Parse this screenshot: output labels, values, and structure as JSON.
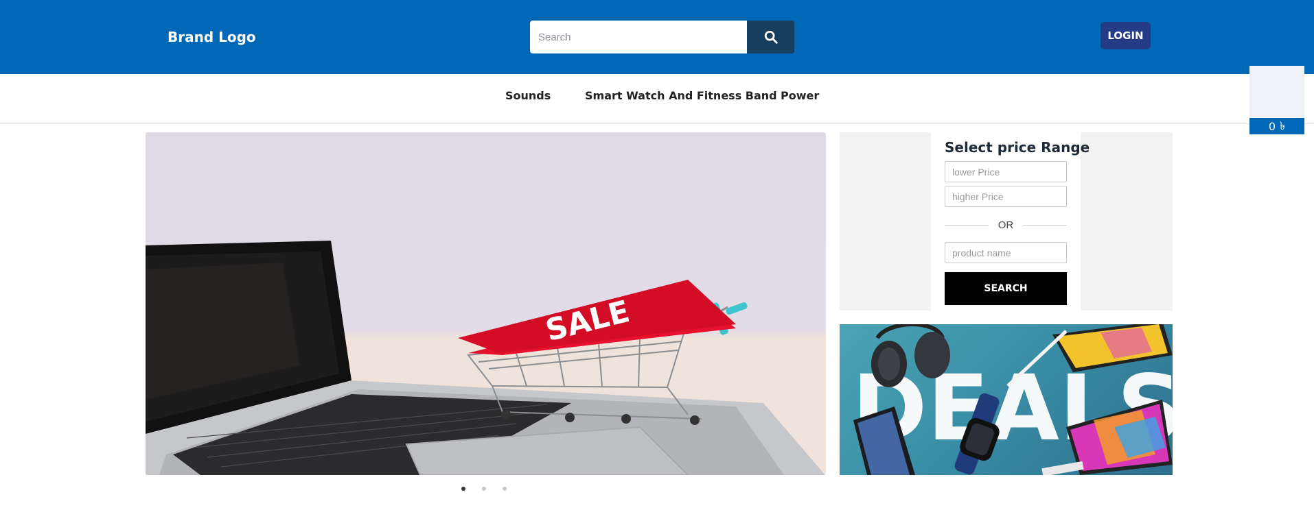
{
  "header": {
    "brand": "Brand Logo",
    "search_placeholder": "Search",
    "login_label": "LOGIN",
    "colors": {
      "bar": "#0068b7",
      "search_button": "#173e5c",
      "login_button": "#253b85"
    }
  },
  "nav": {
    "items": [
      {
        "label": "Sounds"
      },
      {
        "label": "Smart Watch And Fitness Band"
      },
      {
        "label": "Power"
      }
    ]
  },
  "cart": {
    "count": "0",
    "currency_symbol": "৳"
  },
  "hero": {
    "sale_text": "SALE",
    "slides": 3,
    "active_slide": 1
  },
  "filter": {
    "title": "Select price Range",
    "lower_placeholder": "lower Price",
    "higher_placeholder": "higher Price",
    "or_label": "OR",
    "product_placeholder": "product name",
    "search_label": "SEARCH"
  },
  "deals": {
    "text": "DEALS"
  },
  "icons": {
    "search": "search-icon",
    "cart_currency": "taka-icon"
  }
}
